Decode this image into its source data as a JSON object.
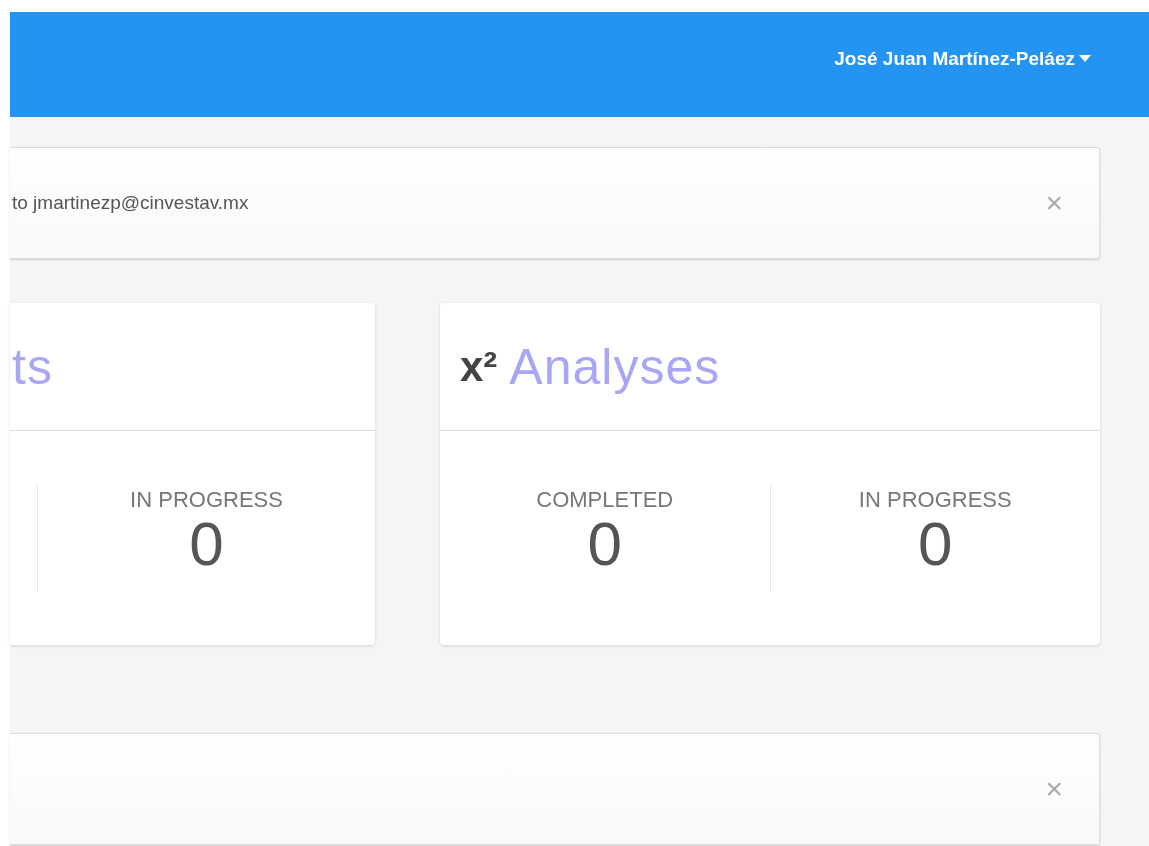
{
  "header": {
    "user_menu": {
      "label": "José Juan Martínez-Peláez"
    }
  },
  "alerts": [
    {
      "message": "to jmartinezp@cinvestav.mx",
      "close": "×"
    },
    {
      "close": "×"
    }
  ],
  "cards": [
    {
      "kind": "clipped",
      "title": "ts",
      "stats": [
        {
          "label": "IN PROGRESS",
          "value": "0"
        }
      ]
    },
    {
      "kind": "full",
      "icon": "x²",
      "title": "Analyses",
      "stats": [
        {
          "label": "COMPLETED",
          "value": "0"
        },
        {
          "label": "IN PROGRESS",
          "value": "0"
        }
      ]
    }
  ]
}
